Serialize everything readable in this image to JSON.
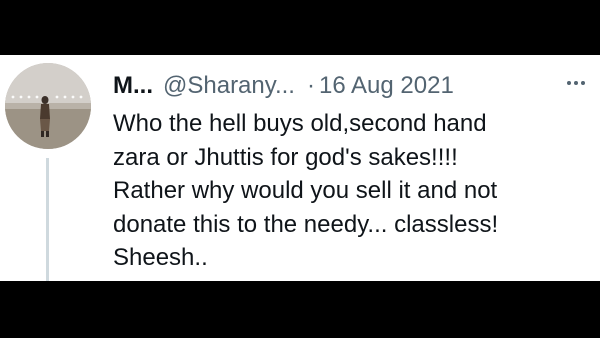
{
  "tweet": {
    "display_name": "M...",
    "handle": "@Sharany...",
    "separator": "·",
    "date": "16 Aug 2021",
    "avatar_icon": "profile-photo-icon",
    "more_icon": "more-options-icon",
    "text_lines": [
      "Who the hell buys old,second hand",
      "zara or Jhuttis for god's sakes!!!!",
      "Rather why would you sell it and not",
      "donate this to the needy... classless!",
      "Sheesh.."
    ]
  },
  "colors": {
    "background": "#000000",
    "card": "#ffffff",
    "text_primary": "#0f1419",
    "text_secondary": "#536471",
    "thread_line": "#cfd9de"
  }
}
